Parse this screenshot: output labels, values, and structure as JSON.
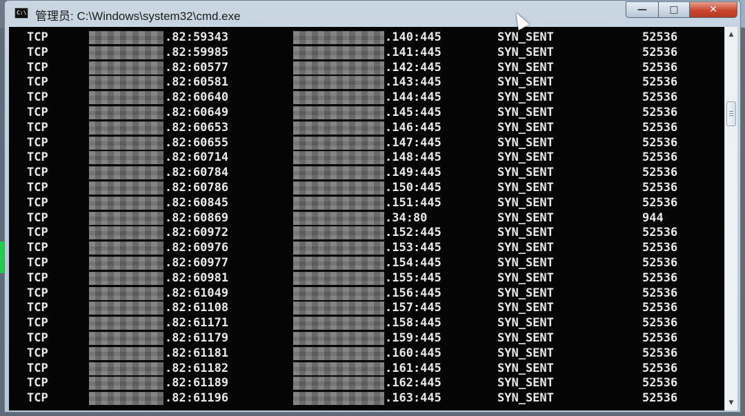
{
  "window": {
    "title": "管理员: C:\\Windows\\system32\\cmd.exe",
    "app_icon_label": "C:\\",
    "buttons": {
      "minimize": "—",
      "maximize": "□",
      "close": "✕"
    }
  },
  "console": {
    "rows": [
      {
        "proto": "TCP",
        "local": ".82:59343",
        "remote": ".140:445",
        "state": "SYN_SENT",
        "pid": "52536"
      },
      {
        "proto": "TCP",
        "local": ".82:59985",
        "remote": ".141:445",
        "state": "SYN_SENT",
        "pid": "52536"
      },
      {
        "proto": "TCP",
        "local": ".82:60577",
        "remote": ".142:445",
        "state": "SYN_SENT",
        "pid": "52536"
      },
      {
        "proto": "TCP",
        "local": ".82:60581",
        "remote": ".143:445",
        "state": "SYN_SENT",
        "pid": "52536"
      },
      {
        "proto": "TCP",
        "local": ".82:60640",
        "remote": ".144:445",
        "state": "SYN_SENT",
        "pid": "52536"
      },
      {
        "proto": "TCP",
        "local": ".82:60649",
        "remote": ".145:445",
        "state": "SYN_SENT",
        "pid": "52536"
      },
      {
        "proto": "TCP",
        "local": ".82:60653",
        "remote": ".146:445",
        "state": "SYN_SENT",
        "pid": "52536"
      },
      {
        "proto": "TCP",
        "local": ".82:60655",
        "remote": ".147:445",
        "state": "SYN_SENT",
        "pid": "52536"
      },
      {
        "proto": "TCP",
        "local": ".82:60714",
        "remote": ".148:445",
        "state": "SYN_SENT",
        "pid": "52536"
      },
      {
        "proto": "TCP",
        "local": ".82:60784",
        "remote": ".149:445",
        "state": "SYN_SENT",
        "pid": "52536"
      },
      {
        "proto": "TCP",
        "local": ".82:60786",
        "remote": ".150:445",
        "state": "SYN_SENT",
        "pid": "52536"
      },
      {
        "proto": "TCP",
        "local": ".82:60845",
        "remote": ".151:445",
        "state": "SYN_SENT",
        "pid": "52536"
      },
      {
        "proto": "TCP",
        "local": ".82:60869",
        "remote": ".34:80",
        "state": "SYN_SENT",
        "pid": "944"
      },
      {
        "proto": "TCP",
        "local": ".82:60972",
        "remote": ".152:445",
        "state": "SYN_SENT",
        "pid": "52536"
      },
      {
        "proto": "TCP",
        "local": ".82:60976",
        "remote": ".153:445",
        "state": "SYN_SENT",
        "pid": "52536"
      },
      {
        "proto": "TCP",
        "local": ".82:60977",
        "remote": ".154:445",
        "state": "SYN_SENT",
        "pid": "52536"
      },
      {
        "proto": "TCP",
        "local": ".82:60981",
        "remote": ".155:445",
        "state": "SYN_SENT",
        "pid": "52536"
      },
      {
        "proto": "TCP",
        "local": ".82:61049",
        "remote": ".156:445",
        "state": "SYN_SENT",
        "pid": "52536"
      },
      {
        "proto": "TCP",
        "local": ".82:61108",
        "remote": ".157:445",
        "state": "SYN_SENT",
        "pid": "52536"
      },
      {
        "proto": "TCP",
        "local": ".82:61171",
        "remote": ".158:445",
        "state": "SYN_SENT",
        "pid": "52536"
      },
      {
        "proto": "TCP",
        "local": ".82:61179",
        "remote": ".159:445",
        "state": "SYN_SENT",
        "pid": "52536"
      },
      {
        "proto": "TCP",
        "local": ".82:61181",
        "remote": ".160:445",
        "state": "SYN_SENT",
        "pid": "52536"
      },
      {
        "proto": "TCP",
        "local": ".82:61182",
        "remote": ".161:445",
        "state": "SYN_SENT",
        "pid": "52536"
      },
      {
        "proto": "TCP",
        "local": ".82:61189",
        "remote": ".162:445",
        "state": "SYN_SENT",
        "pid": "52536"
      },
      {
        "proto": "TCP",
        "local": ".82:61196",
        "remote": ".163:445",
        "state": "SYN_SENT",
        "pid": "52536"
      }
    ]
  },
  "scrollbar": {
    "up_arrow": "▲",
    "down_arrow": "▼"
  },
  "colors": {
    "console_bg": "#050505",
    "console_text": "#e9e9e9",
    "close_button": "#c9462e"
  }
}
